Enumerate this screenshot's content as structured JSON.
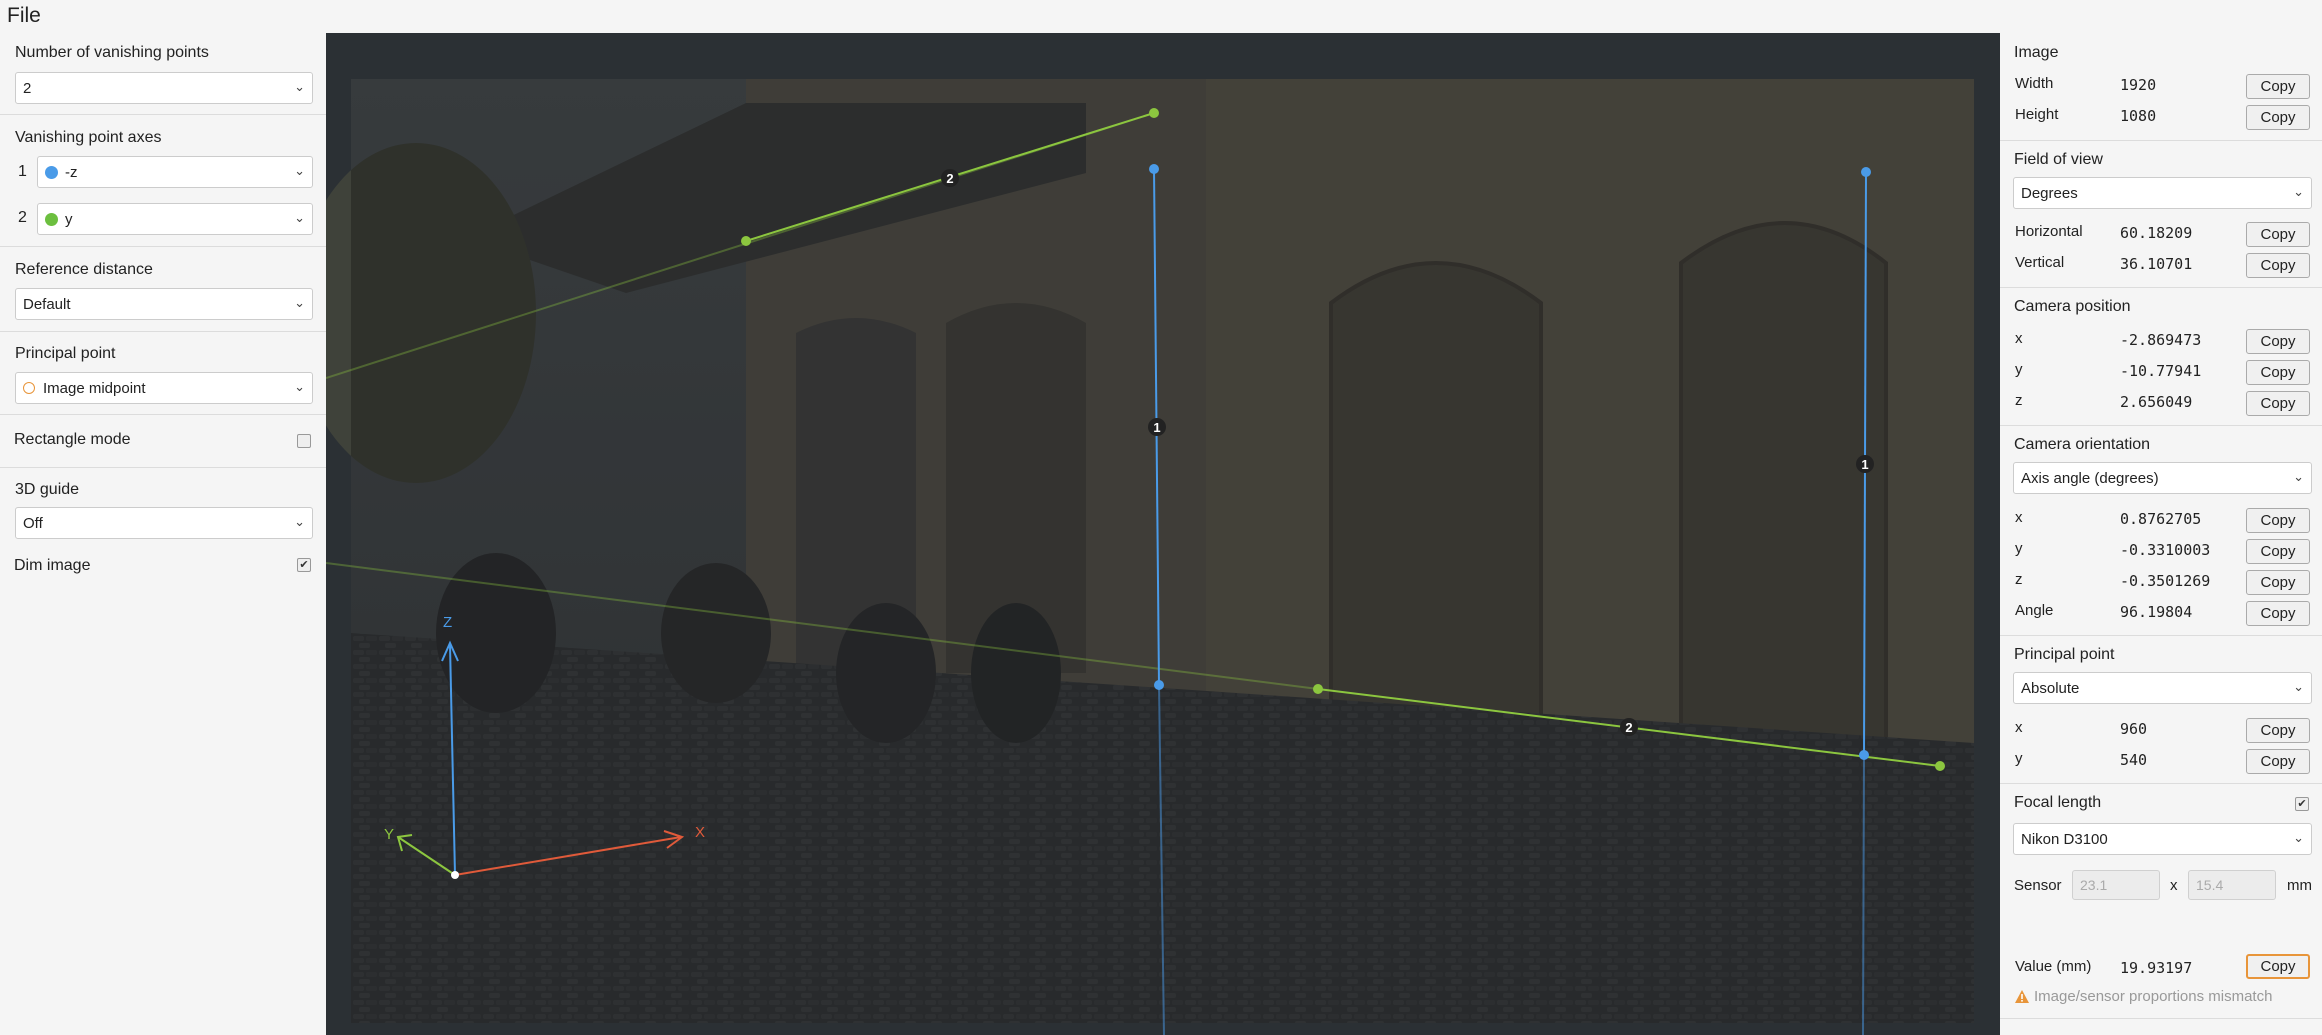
{
  "menu": {
    "file": "File"
  },
  "left": {
    "vp_count": {
      "label": "Number of vanishing points",
      "value": "2"
    },
    "vp_axes": {
      "label": "Vanishing point axes",
      "rows": [
        {
          "index": "1",
          "value": "-z",
          "color": "#4a9be8"
        },
        {
          "index": "2",
          "value": "y",
          "color": "#6cbf3f"
        }
      ]
    },
    "ref_distance": {
      "label": "Reference distance",
      "value": "Default"
    },
    "principal_point": {
      "label": "Principal point",
      "value": "Image midpoint"
    },
    "rectangle_mode": {
      "label": "Rectangle mode",
      "checked": false
    },
    "guide3d": {
      "label": "3D guide",
      "value": "Off"
    },
    "dim_image": {
      "label": "Dim image",
      "checked": true,
      "check": "✔"
    }
  },
  "canvas": {
    "handle_labels": {
      "vp1_a": "1",
      "vp1_b": "1",
      "vp2_a": "2",
      "vp2_b": "2"
    },
    "axes": {
      "z": "Z",
      "x": "X",
      "y": "Y"
    },
    "colors": {
      "vp1": "#4a9be8",
      "vp2": "#8cc63f",
      "x_axis": "#e05a3a",
      "y_axis": "#8cc63f",
      "z_axis": "#4a9be8"
    }
  },
  "right": {
    "image": {
      "title": "Image",
      "rows": [
        {
          "label": "Width",
          "value": "1920",
          "button": "Copy"
        },
        {
          "label": "Height",
          "value": "1080",
          "button": "Copy"
        }
      ]
    },
    "fov": {
      "title": "Field of view",
      "unit": "Degrees",
      "rows": [
        {
          "label": "Horizontal",
          "value": "60.18209",
          "button": "Copy"
        },
        {
          "label": "Vertical",
          "value": "36.10701",
          "button": "Copy"
        }
      ]
    },
    "cam_pos": {
      "title": "Camera position",
      "rows": [
        {
          "label": "x",
          "value": "-2.869473",
          "button": "Copy"
        },
        {
          "label": "y",
          "value": "-10.77941",
          "button": "Copy"
        },
        {
          "label": "z",
          "value": "2.656049",
          "button": "Copy"
        }
      ]
    },
    "cam_orient": {
      "title": "Camera orientation",
      "mode": "Axis angle (degrees)",
      "rows": [
        {
          "label": "x",
          "value": "0.8762705",
          "button": "Copy"
        },
        {
          "label": "y",
          "value": "-0.3310003",
          "button": "Copy"
        },
        {
          "label": "z",
          "value": "-0.3501269",
          "button": "Copy"
        },
        {
          "label": "Angle",
          "value": "96.19804",
          "button": "Copy"
        }
      ]
    },
    "pp": {
      "title": "Principal point",
      "mode": "Absolute",
      "rows": [
        {
          "label": "x",
          "value": "960",
          "button": "Copy"
        },
        {
          "label": "y",
          "value": "540",
          "button": "Copy"
        }
      ]
    },
    "focal": {
      "title": "Focal length",
      "checked": true,
      "check": "✔",
      "camera": "Nikon D3100",
      "sensor_label": "Sensor",
      "sensor_w": "23.1",
      "sensor_x": "x",
      "sensor_h": "15.4",
      "sensor_unit": "mm",
      "value_label": "Value (mm)",
      "value": "19.93197",
      "button": "Copy",
      "warning": "Image/sensor proportions mismatch"
    }
  }
}
